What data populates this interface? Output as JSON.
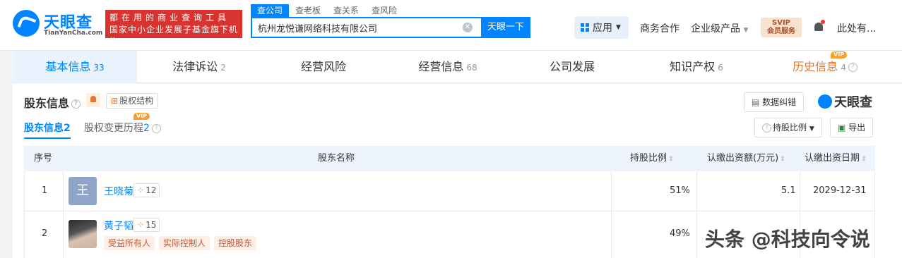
{
  "header": {
    "logo_name": "天眼查",
    "logo_domain": "TianYanCha.com",
    "banner_line1": "都在用的商业查询工具",
    "banner_line2": "国家中小企业发展子基金旗下机构",
    "search_tabs": [
      "查公司",
      "查老板",
      "查关系",
      "查风险"
    ],
    "search_value": "杭州龙悦谦网络科技有限公司",
    "search_button": "天眼一下",
    "apps_label": "应用",
    "nav_business": "商务合作",
    "nav_enterprise": "企业级产品",
    "svip_line1": "SVIP",
    "svip_line2": "会员服务",
    "user_label": "此处有..."
  },
  "tabs": [
    {
      "label": "基本信息",
      "count": "33"
    },
    {
      "label": "法律诉讼",
      "count": "2"
    },
    {
      "label": "经营风险",
      "count": ""
    },
    {
      "label": "经营信息",
      "count": "68"
    },
    {
      "label": "公司发展",
      "count": ""
    },
    {
      "label": "知识产权",
      "count": "6"
    },
    {
      "label": "历史信息",
      "count": "4"
    }
  ],
  "vip_text": "VIP",
  "section": {
    "title": "股东信息",
    "equity_button": "股权结构",
    "subtab1": "股东信息",
    "subtab1_count": "2",
    "subtab2": "股权变更历程",
    "subtab2_count": "2",
    "error_button": "数据纠错",
    "brand": "天眼查",
    "ratio_button": "持股比例",
    "export_button": "导出"
  },
  "table": {
    "headers": [
      "序号",
      "股东名称",
      "持股比例",
      "认缴出资额(万元)",
      "认缴出资日期"
    ],
    "rows": [
      {
        "index": "1",
        "avatar": "王",
        "name": "王晓菊",
        "relations": "12",
        "ratio": "51%",
        "amount": "5.1",
        "date": "2029-12-31",
        "tags": []
      },
      {
        "index": "2",
        "avatar": "",
        "name": "黄子韬",
        "relations": "15",
        "ratio": "49%",
        "amount": "",
        "date": "",
        "tags": [
          "受益所有人",
          "实际控制人",
          "控股股东"
        ]
      }
    ]
  },
  "watermark": "头条 @科技向令说",
  "colors": {
    "brand_blue": "#0084ff",
    "banner_red": "#d73431",
    "history_orange": "#e6762e"
  }
}
